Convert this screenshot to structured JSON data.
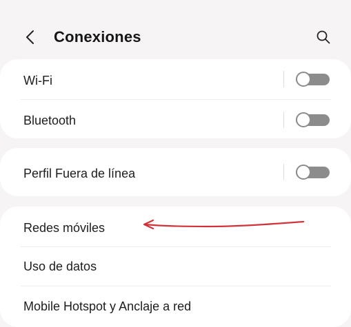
{
  "header": {
    "title": "Conexiones",
    "back_icon": "chevron-left-icon",
    "search_icon": "search-icon"
  },
  "groups": [
    {
      "items": [
        {
          "label": "Wi-Fi",
          "toggle": "off"
        },
        {
          "label": "Bluetooth",
          "toggle": "off"
        }
      ]
    },
    {
      "items": [
        {
          "label": "Perfil Fuera de línea",
          "toggle": "off"
        }
      ]
    },
    {
      "items": [
        {
          "label": "Redes móviles"
        },
        {
          "label": "Uso de datos"
        },
        {
          "label": "Mobile Hotspot y Anclaje a red"
        }
      ]
    }
  ],
  "annotation": {
    "type": "hand-drawn-arrow",
    "points_to": "Redes móviles",
    "color": "#d1323a"
  },
  "colors": {
    "background": "#f6f4f4",
    "card": "#ffffff",
    "toggle_off": "#8c8c8c",
    "text": "#1b1b1b"
  }
}
